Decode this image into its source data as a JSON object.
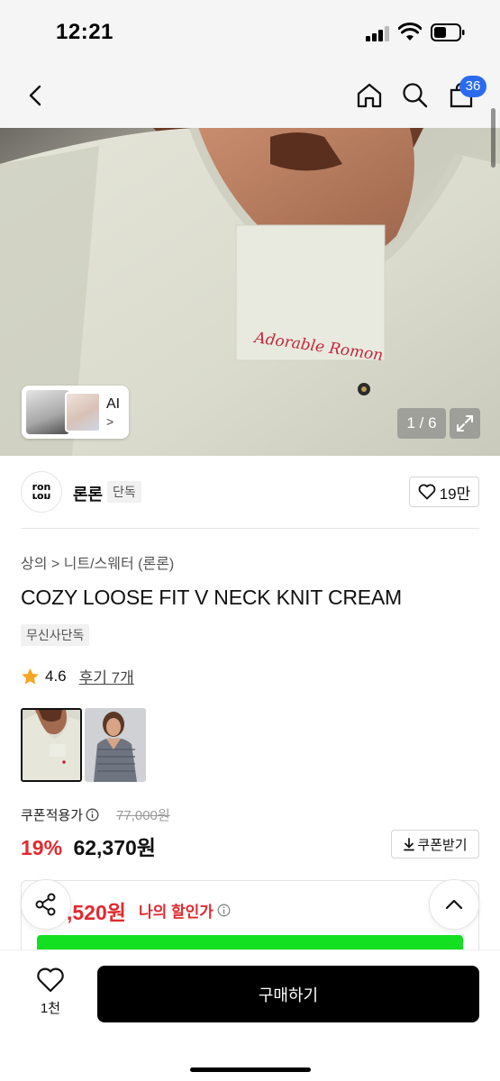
{
  "status_bar": {
    "time": "12:21"
  },
  "nav": {
    "cart_count": "36"
  },
  "gallery": {
    "ai_label": "AI",
    "ai_chevron": ">",
    "page_indicator": "1 / 6",
    "embroidery_text": "Adorable Romon"
  },
  "brand": {
    "logo_top": "ron",
    "logo_bottom": "ron",
    "name": "론론",
    "tag": "단독",
    "like_count": "19만"
  },
  "product": {
    "breadcrumb": "상의 > 니트/스웨터 (론론)",
    "title": "COZY LOOSE FIT V NECK KNIT CREAM",
    "exclusive_badge": "무신사단독",
    "rating": "4.6",
    "review_link": "후기 7개",
    "swatch_count": 2
  },
  "pricing": {
    "coupon_label": "쿠폰적용가",
    "original_price": "77,000원",
    "discount": "19%",
    "price": "62,370원",
    "coupon_button": "쿠폰받기",
    "my_price": ",520원",
    "my_price_label": "나의 할인가"
  },
  "bottom": {
    "wish_count": "1천",
    "buy_button": "구매하기"
  },
  "colors": {
    "accent_red": "#e2292e",
    "badge_blue": "#2a6bf2",
    "buy_black": "#000000",
    "green_bar": "#12e020"
  }
}
